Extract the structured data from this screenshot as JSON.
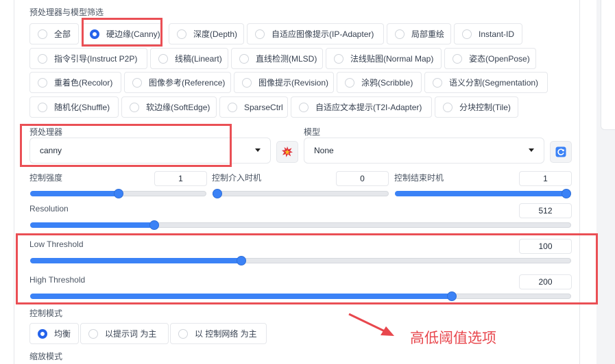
{
  "preprocessor_filter": {
    "label": "预处理器与模型筛选",
    "options": [
      "全部",
      "硬边缘(Canny)",
      "深度(Depth)",
      "自适应图像提示(IP-Adapter)",
      "局部重绘",
      "Instant-ID",
      "指令引导(Instruct P2P)",
      "线稿(Lineart)",
      "直线检测(MLSD)",
      "法线贴图(Normal Map)",
      "姿态(OpenPose)",
      "重着色(Recolor)",
      "图像参考(Reference)",
      "图像提示(Revision)",
      "涂鸦(Scribble)",
      "语义分割(Segmentation)",
      "随机化(Shuffle)",
      "软边缘(SoftEdge)",
      "SparseCtrl",
      "自适应文本提示(T2I-Adapter)",
      "分块控制(Tile)"
    ],
    "selected": "硬边缘(Canny)"
  },
  "preprocessor": {
    "label": "预处理器",
    "value": "canny"
  },
  "model": {
    "label": "模型",
    "value": "None"
  },
  "icons": {
    "run_preprocessor": "explosion-icon",
    "refresh": "refresh-icon"
  },
  "control_weight": {
    "label": "控制强度",
    "value": "1",
    "fraction": 0.5
  },
  "starting_step": {
    "label": "控制介入时机",
    "value": "0",
    "fraction": 0.0
  },
  "ending_step": {
    "label": "控制结束时机",
    "value": "1",
    "fraction": 1.0
  },
  "resolution": {
    "label": "Resolution",
    "value": "512",
    "fraction": 0.23
  },
  "low_threshold": {
    "label": "Low Threshold",
    "value": "100",
    "fraction": 0.39
  },
  "high_threshold": {
    "label": "High Threshold",
    "value": "200",
    "fraction": 0.78
  },
  "control_mode": {
    "label": "控制模式",
    "options": [
      "均衡",
      "以提示词 为主",
      "以 控制网络 为主"
    ],
    "selected": "均衡"
  },
  "resize_mode": {
    "label": "缩放模式"
  },
  "annotation": {
    "text": "高低阈值选项"
  },
  "colors": {
    "accent": "#3b82f6",
    "annotation": "#ea4f55"
  }
}
